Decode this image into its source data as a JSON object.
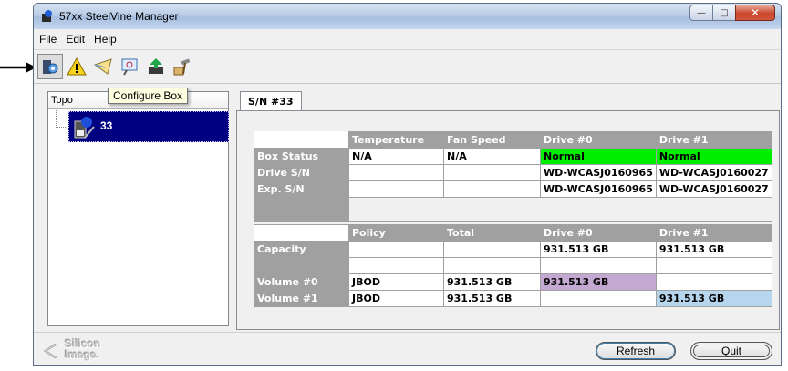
{
  "window": {
    "title": "57xx SteelVine Manager"
  },
  "menu": [
    {
      "label": "File"
    },
    {
      "label": "Edit"
    },
    {
      "label": "Help"
    }
  ],
  "toolbar_icons": [
    "configure-box-icon",
    "warning-icon",
    "mail-icon",
    "view-icon",
    "install-icon",
    "hammer-icon"
  ],
  "tooltip": "Configure Box",
  "tree": {
    "header": "Topo",
    "node_label": "33"
  },
  "tab": {
    "label": "S/N #33"
  },
  "status_table": {
    "headers": [
      "",
      "Temperature",
      "Fan Speed",
      "Drive #0",
      "Drive #1"
    ],
    "rows": [
      {
        "label": "Box Status",
        "cells": [
          "N/A",
          "N/A",
          "Normal",
          "Normal"
        ]
      },
      {
        "label": "Drive S/N",
        "cells": [
          "",
          "",
          "WD-WCASJ0160965",
          "WD-WCASJ0160027"
        ]
      },
      {
        "label": "Exp. S/N",
        "cells": [
          "",
          "",
          "WD-WCASJ0160965",
          "WD-WCASJ0160027"
        ]
      }
    ]
  },
  "volume_table": {
    "headers": [
      "",
      "Policy",
      "Total",
      "Drive #0",
      "Drive #1"
    ],
    "rows": [
      {
        "label": "Capacity",
        "cells": [
          "",
          "",
          "931.513 GB",
          "931.513 GB"
        ]
      },
      {
        "label": "Volume #0",
        "cells": [
          "JBOD",
          "931.513 GB",
          "931.513 GB",
          ""
        ]
      },
      {
        "label": "Volume #1",
        "cells": [
          "JBOD",
          "931.513 GB",
          "",
          "931.513 GB"
        ]
      }
    ]
  },
  "buttons": {
    "refresh": "Refresh",
    "quit": "Quit"
  },
  "logo": {
    "line1": "Silicon",
    "line2": "Image."
  },
  "colors": {
    "normal": "#00ee00",
    "volume0": "#c3a8d2",
    "volume1": "#b6d6ee",
    "header_gray": "#a0a0a0",
    "selection": "#000080"
  }
}
